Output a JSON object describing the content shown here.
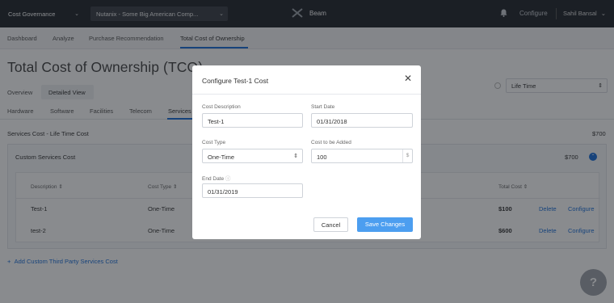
{
  "topbar": {
    "cost_select": "Cost Governance",
    "product_select": "Nutanix - Some Big American Comp...",
    "brand": "Beam",
    "configure": "Configure",
    "user": "Sahil Bansal"
  },
  "nav": {
    "items": [
      "Dashboard",
      "Analyze",
      "Purchase Recommendation",
      "Total Cost of Ownership"
    ],
    "active": "Total Cost of Ownership"
  },
  "page": {
    "title": "Total Cost of Ownership (TCO)",
    "view_tabs": [
      "Overview",
      "Detailed View"
    ],
    "time_range": "Life Time",
    "sub_tabs": [
      "Hardware",
      "Software",
      "Facilities",
      "Telecom",
      "Services"
    ],
    "services_title": "Services Cost - Life Time Cost",
    "services_total": "$700"
  },
  "panel": {
    "title": "Custom Services Cost",
    "total": "$700",
    "columns": {
      "description": "Description",
      "cost_type": "Cost Type",
      "total_cost": "Total Cost"
    },
    "rows": [
      {
        "description": "Test-1",
        "cost_type": "One-Time",
        "total": "$100",
        "delete": "Delete",
        "configure": "Configure"
      },
      {
        "description": "test-2",
        "cost_type": "One-Time",
        "total": "$600",
        "delete": "Delete",
        "configure": "Configure"
      }
    ]
  },
  "add_link": "Add Custom Third Party Services Cost",
  "modal": {
    "title": "Configure Test-1 Cost",
    "fields": {
      "description_label": "Cost Description",
      "description_value": "Test-1",
      "start_label": "Start Date",
      "start_value": "01/31/2018",
      "type_label": "Cost Type",
      "type_value": "One-Time",
      "amount_label": "Cost to be Added",
      "amount_value": "100",
      "amount_unit": "$",
      "end_label": "End Date",
      "end_value": "01/31/2019"
    },
    "cancel": "Cancel",
    "save": "Save Changes"
  },
  "help_label": "?",
  "colors": {
    "accent": "#1b6fd8",
    "topbar": "#22262c",
    "save_button": "#4c9ef0"
  }
}
